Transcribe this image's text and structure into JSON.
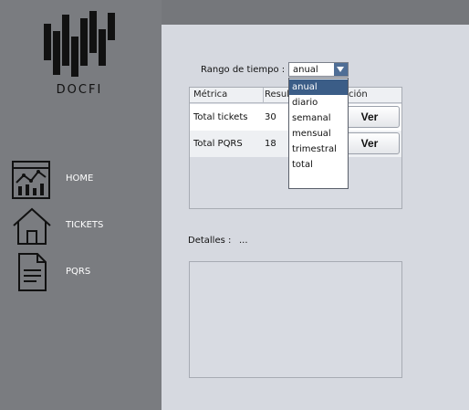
{
  "brand": {
    "name": "DOCFI"
  },
  "sidebar": {
    "items": [
      {
        "label": "HOME",
        "icon": "dashboard-icon"
      },
      {
        "label": "TICKETS",
        "icon": "house-icon"
      },
      {
        "label": "PQRS",
        "icon": "document-icon"
      }
    ]
  },
  "filter": {
    "label": "Rango de tiempo :",
    "selected": "anual",
    "options": [
      "anual",
      "diario",
      "semanal",
      "mensual",
      "trimestral",
      "total"
    ]
  },
  "table": {
    "headers": [
      "Métrica",
      "Resul",
      "ción"
    ],
    "rows": [
      {
        "metric": "Total tickets",
        "result": "30",
        "action": "Ver"
      },
      {
        "metric": "Total PQRS",
        "result": "18",
        "action": "Ver"
      }
    ]
  },
  "details": {
    "label": "Detalles :",
    "value": "..."
  },
  "colors": {
    "sidebar": "#7a7c80",
    "topbar": "#75777b",
    "content": "#d6d9e0",
    "selection": "#3b5d87"
  }
}
